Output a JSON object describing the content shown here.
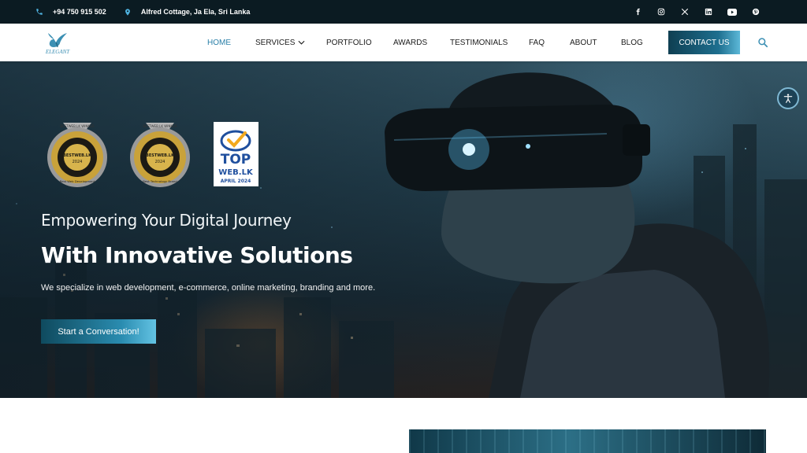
{
  "topbar": {
    "phone": "+94 750 915 502",
    "address": "Alfred Cottage, Ja Ela, Sri Lanka",
    "social": [
      "facebook-icon",
      "instagram-icon",
      "x-icon",
      "linkedin-icon",
      "youtube-icon",
      "pinterest-icon"
    ]
  },
  "nav": {
    "logo_text": "ELEGANT",
    "items": [
      "HOME",
      "SERVICES",
      "PORTFOLIO",
      "AWARDS",
      "TESTIMONIALS",
      "FAQ",
      "ABOUT",
      "BLOG"
    ],
    "active": "HOME",
    "contact_label": "CONTACT US"
  },
  "hero": {
    "badge1_top": "BESTWEB.LK",
    "badge1_bottom": "Best Web Development",
    "badge2_top": "BESTWEB.LK",
    "badge2_bottom": "Best Technology Brand",
    "badge_year": "2024",
    "badge_ribbon": "BESTWEB.LK WINNER",
    "topweb_line1": "TOP",
    "topweb_line2": "WEB.LK",
    "topweb_line3": "APRIL 2024",
    "subtitle": "Empowering Your Digital Journey",
    "title": "With Innovative Solutions",
    "description": "We specialize in web development, e-commerce, online marketing, branding and more.",
    "cta_label": "Start a Conversation!"
  },
  "colors": {
    "topbar_bg": "#0b1b22",
    "accent": "#2a7fa8",
    "button_dark": "#0f3f52"
  }
}
